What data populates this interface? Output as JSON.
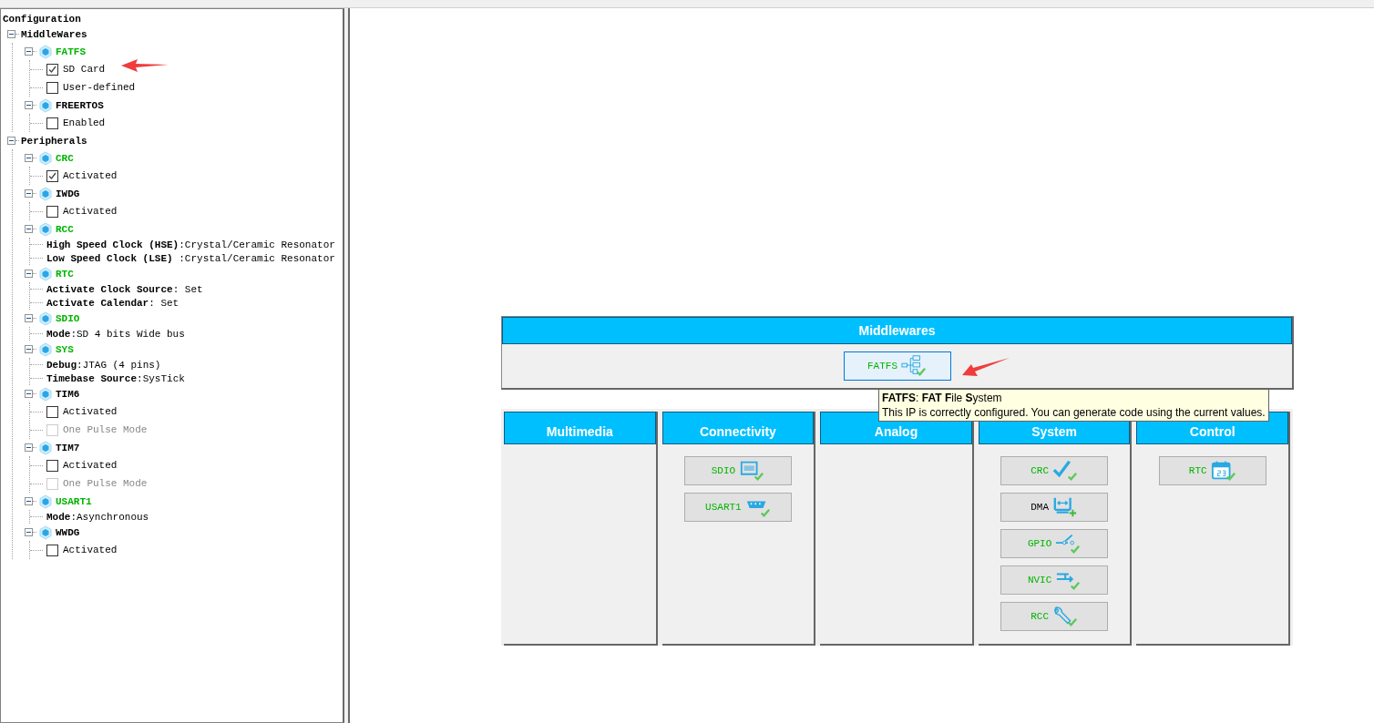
{
  "tree": {
    "label": "Configuration",
    "children": [
      {
        "kind": "category",
        "label": "MiddleWares",
        "expanded": true,
        "children": [
          {
            "kind": "ip",
            "label": "FATFS",
            "configured": true,
            "expanded": true,
            "children": [
              {
                "kind": "checkbox",
                "label": "SD Card",
                "checked": true,
                "disabled": false
              },
              {
                "kind": "checkbox",
                "label": "User-defined",
                "checked": false,
                "disabled": false
              }
            ]
          },
          {
            "kind": "ip",
            "label": "FREERTOS",
            "configured": false,
            "expanded": true,
            "children": [
              {
                "kind": "checkbox",
                "label": "Enabled",
                "checked": false,
                "disabled": false
              }
            ]
          }
        ]
      },
      {
        "kind": "category",
        "label": "Peripherals",
        "expanded": true,
        "children": [
          {
            "kind": "ip",
            "label": "CRC",
            "configured": true,
            "expanded": true,
            "children": [
              {
                "kind": "checkbox",
                "label": "Activated",
                "checked": true,
                "disabled": false
              }
            ]
          },
          {
            "kind": "ip",
            "label": "IWDG",
            "configured": false,
            "expanded": true,
            "children": [
              {
                "kind": "checkbox",
                "label": "Activated",
                "checked": false,
                "disabled": false
              }
            ]
          },
          {
            "kind": "ip",
            "label": "RCC",
            "configured": true,
            "expanded": true,
            "children": [
              {
                "kind": "property",
                "text": "**High Speed Clock (HSE)**:Crystal/Ceramic Resonator"
              },
              {
                "kind": "property",
                "text": "**Low Speed Clock (LSE)** :Crystal/Ceramic Resonator"
              }
            ]
          },
          {
            "kind": "ip",
            "label": "RTC",
            "configured": true,
            "expanded": true,
            "children": [
              {
                "kind": "property",
                "text": "**Activate Clock Source**: Set"
              },
              {
                "kind": "property",
                "text": "**Activate Calendar**: Set"
              }
            ]
          },
          {
            "kind": "ip",
            "label": "SDIO",
            "configured": true,
            "expanded": true,
            "children": [
              {
                "kind": "property",
                "text": "**Mode**:SD 4 bits Wide bus"
              }
            ]
          },
          {
            "kind": "ip",
            "label": "SYS",
            "configured": true,
            "expanded": true,
            "children": [
              {
                "kind": "property",
                "text": "**Debug**:JTAG (4 pins)"
              },
              {
                "kind": "property",
                "text": "**Timebase Source**:SysTick"
              }
            ]
          },
          {
            "kind": "ip",
            "label": "TIM6",
            "configured": false,
            "expanded": true,
            "children": [
              {
                "kind": "checkbox",
                "label": "Activated",
                "checked": false,
                "disabled": false
              },
              {
                "kind": "checkbox",
                "label": "One Pulse Mode",
                "checked": false,
                "disabled": true
              }
            ]
          },
          {
            "kind": "ip",
            "label": "TIM7",
            "configured": false,
            "expanded": true,
            "children": [
              {
                "kind": "checkbox",
                "label": "Activated",
                "checked": false,
                "disabled": false
              },
              {
                "kind": "checkbox",
                "label": "One Pulse Mode",
                "checked": false,
                "disabled": true
              }
            ]
          },
          {
            "kind": "ip",
            "label": "USART1",
            "configured": true,
            "expanded": true,
            "children": [
              {
                "kind": "property",
                "text": "**Mode**:Asynchronous"
              }
            ]
          },
          {
            "kind": "ip",
            "label": "WWDG",
            "configured": false,
            "expanded": true,
            "children": [
              {
                "kind": "checkbox",
                "label": "Activated",
                "checked": false,
                "disabled": false
              }
            ]
          }
        ]
      }
    ]
  },
  "middlewares": {
    "title": "Middlewares",
    "items": [
      {
        "label": "FATFS",
        "kind": "tree",
        "configured": true,
        "selected": true
      }
    ]
  },
  "categories": [
    {
      "title": "Multimedia"
    },
    {
      "title": "Connectivity",
      "items": [
        {
          "label": "SDIO",
          "kind": "sdcard",
          "configured": true,
          "selected": false
        },
        {
          "label": "USART1",
          "kind": "serial",
          "configured": true,
          "selected": false
        }
      ]
    },
    {
      "title": "Analog"
    },
    {
      "title": "System",
      "items": [
        {
          "label": "CRC",
          "kind": "check",
          "configured": true,
          "selected": false
        },
        {
          "label": "DMA",
          "kind": "dma",
          "configured": false,
          "selected": false
        },
        {
          "label": "GPIO",
          "kind": "switch",
          "configured": true,
          "selected": false
        },
        {
          "label": "NVIC",
          "kind": "nvic",
          "configured": true,
          "selected": false
        },
        {
          "label": "RCC",
          "kind": "wrench",
          "configured": true,
          "selected": false
        }
      ]
    },
    {
      "title": "Control",
      "items": [
        {
          "label": "RTC",
          "kind": "calendar",
          "configured": true,
          "selected": false
        }
      ]
    }
  ],
  "tooltip": {
    "title": "**FATFS**: **FAT F**ile **S**ystem",
    "text": "This IP is correctly configured. You can generate code using the current values."
  }
}
